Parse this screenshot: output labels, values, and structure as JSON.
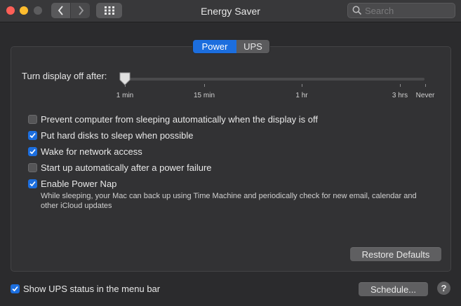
{
  "window": {
    "title": "Energy Saver",
    "search_placeholder": "Search"
  },
  "tabs": [
    {
      "label": "Power",
      "selected": true
    },
    {
      "label": "UPS",
      "selected": false
    }
  ],
  "slider": {
    "label": "Turn display off after:",
    "value_fraction": 0.0,
    "tick_labels": [
      "1 min",
      "15 min",
      "1 hr",
      "3 hrs",
      "Never"
    ]
  },
  "options": [
    {
      "label": "Prevent computer from sleeping automatically when the display is off",
      "checked": false
    },
    {
      "label": "Put hard disks to sleep when possible",
      "checked": true
    },
    {
      "label": "Wake for network access",
      "checked": true
    },
    {
      "label": "Start up automatically after a power failure",
      "checked": false
    },
    {
      "label": "Enable Power Nap",
      "checked": true
    }
  ],
  "power_nap_description": "While sleeping, your Mac can back up using Time Machine and periodically check for new email, calendar and other iCloud updates",
  "restore_defaults_label": "Restore Defaults",
  "ups_status": {
    "label": "Show UPS status in the menu bar",
    "checked": true
  },
  "schedule_label": "Schedule...",
  "help_label": "?",
  "colors": {
    "accent": "#1c6ede",
    "background": "#2b2b2d"
  }
}
